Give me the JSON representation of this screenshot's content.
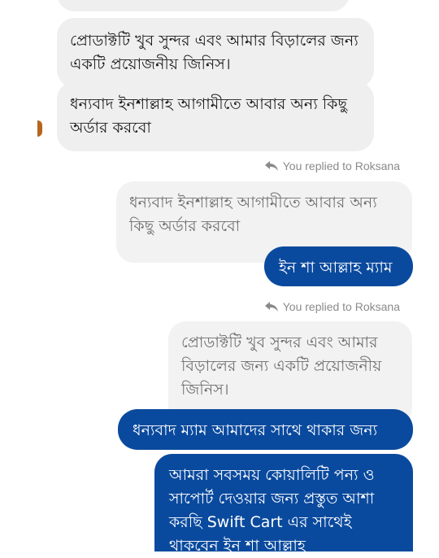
{
  "chat": {
    "incoming_messages": [
      {
        "text": "প্রোডাক্টটি খুব সুন্দর এবং আমার বিড়ালের জন্য একটি প্রয়োজনীয় জিনিস।"
      },
      {
        "text": "ধন্যবাদ ইনশাল্লাহ আগামীতে আবার অন্য কিছু অর্ডার করবো"
      }
    ],
    "reply_groups": [
      {
        "note": "You replied to Roksana",
        "quoted": "ধন্যবাদ ইনশাল্লাহ আগামীতে আবার অন্য কিছু অর্ডার করবো",
        "replies": [
          "ইন শা আল্লাহ ম্যাম"
        ]
      },
      {
        "note": "You replied to Roksana",
        "quoted": "প্রোডাক্টটি খুব সুন্দর এবং আমার বিড়ালের জন্য একটি প্রয়োজনীয় জিনিস।",
        "replies": [
          "ধন্যবাদ ম্যাম আমাদের সাথে থাকার জন্য",
          "আমরা সবসময় কোয়ালিটি পন্য ও সাপোর্ট দেওয়ার জন্য প্রস্তুত আশা করছি Swift Cart এর সাথেই থাকবেন ইন শা আল্লাহ"
        ]
      }
    ]
  },
  "icons": {
    "reply": "reply-arrow-icon"
  },
  "colors": {
    "outgoing_bubble": "#0a4a9e",
    "incoming_bubble": "#efefef",
    "quoted_text": "#6f6f6f"
  }
}
